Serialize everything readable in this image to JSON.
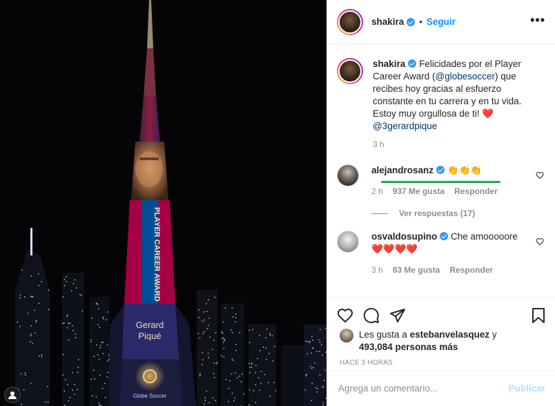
{
  "post": {
    "username": "shakira",
    "dot": "•",
    "follow_label": "Seguir",
    "more_label": "•••"
  },
  "caption": {
    "username": "shakira",
    "text_1": "Felicidades por el Player Career Award (",
    "mention_1": "@globesoccer",
    "text_2": ") que recibes hoy gracias al esfuerzo constante en tu carrera y en tu vida. Estoy muy orgullosa de ti! ",
    "heart": "❤️",
    "mention_2": "@3gerardpique",
    "time": "3 h"
  },
  "comments": [
    {
      "username": "alejandrosanz",
      "text": "👏👏👏",
      "time": "2 h",
      "likes": "937 Me gusta",
      "reply_label": "Responder",
      "view_replies": "Ver respuestas (17)"
    },
    {
      "username": "osvaldosupino",
      "text": "Che amooooore",
      "hearts": "❤️❤️❤️❤️",
      "time": "3 h",
      "likes": "83 Me gusta",
      "reply_label": "Responder"
    }
  ],
  "likes": {
    "prefix": "Les gusta a ",
    "user": "estebanvelasquez",
    "mid": " y ",
    "count": "493,084 personas más"
  },
  "timestamp": "Hace 3 horas",
  "add_comment": {
    "placeholder": "Agrega un comentario...",
    "publish_label": "Publicar"
  },
  "photo_text": {
    "line1": "PLAYER CAREER AWARD",
    "name1": "Gerard",
    "name2": "Piqué",
    "sponsor": "Globe Soccer"
  },
  "colors": {
    "follow": "#0095f6",
    "verified": "#3897f0",
    "heart": "#e0245e",
    "underline": "#1ea84f",
    "publish_disabled": "#b2dffc"
  },
  "icons": [
    "verified-icon",
    "heart-icon",
    "comment-icon",
    "share-icon",
    "bookmark-icon",
    "more-icon"
  ]
}
